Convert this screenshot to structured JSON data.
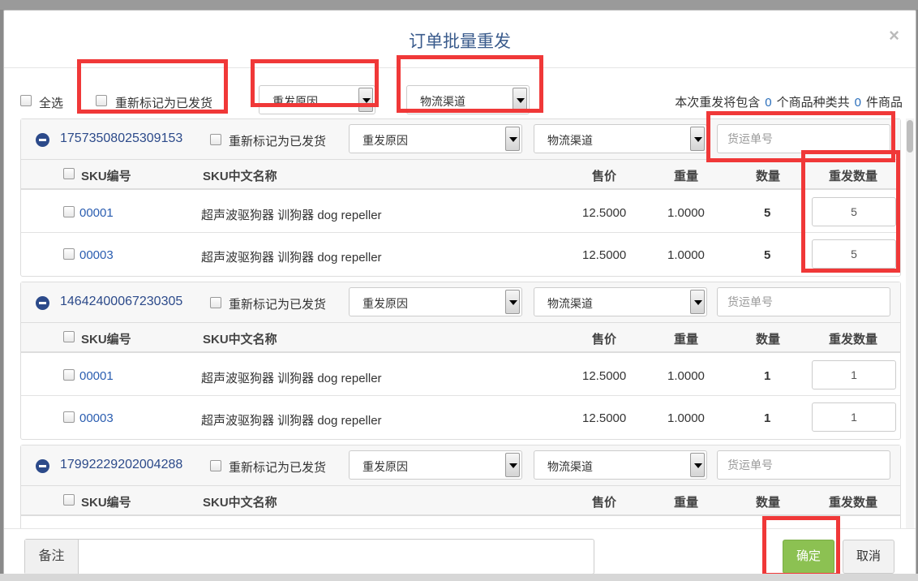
{
  "dialog": {
    "title": "订单批量重发",
    "close_glyph": "×"
  },
  "toolbar": {
    "select_all_label": "全选",
    "remark_shipped_label": "重新标记为已发货",
    "reason_select": "重发原因",
    "channel_select": "物流渠道",
    "summary_prefix": "本次重发将包含",
    "product_kinds": "0",
    "summary_mid": "个商品种类共",
    "product_count": "0",
    "summary_suffix": "件商品"
  },
  "table_headers": {
    "sku_code": "SKU编号",
    "sku_name": "SKU中文名称",
    "price": "售价",
    "weight": "重量",
    "quantity": "数量",
    "resend_qty": "重发数量"
  },
  "tracking_placeholder": "货运单号",
  "orders": [
    {
      "id": "17573508025309153",
      "remark_label": "重新标记为已发货",
      "reason": "重发原因",
      "channel": "物流渠道",
      "items": [
        {
          "sku": "00001",
          "name": "超声波驱狗器 训狗器 dog repeller",
          "price": "12.5000",
          "weight": "1.0000",
          "qty": "5",
          "resend": "5"
        },
        {
          "sku": "00003",
          "name": "超声波驱狗器 训狗器 dog repeller",
          "price": "12.5000",
          "weight": "1.0000",
          "qty": "5",
          "resend": "5"
        }
      ]
    },
    {
      "id": "14642400067230305",
      "remark_label": "重新标记为已发货",
      "reason": "重发原因",
      "channel": "物流渠道",
      "items": [
        {
          "sku": "00001",
          "name": "超声波驱狗器 训狗器 dog repeller",
          "price": "12.5000",
          "weight": "1.0000",
          "qty": "1",
          "resend": "1"
        },
        {
          "sku": "00003",
          "name": "超声波驱狗器 训狗器 dog repeller",
          "price": "12.5000",
          "weight": "1.0000",
          "qty": "1",
          "resend": "1"
        }
      ]
    },
    {
      "id": "17992229202004288",
      "remark_label": "重新标记为已发货",
      "reason": "重发原因",
      "channel": "物流渠道",
      "items": []
    }
  ],
  "footer": {
    "remark_label": "备注",
    "confirm_label": "确定",
    "cancel_label": "取消"
  },
  "colors": {
    "highlight": "#f03838",
    "confirm": "#8cc152",
    "link": "#2a5db0"
  }
}
